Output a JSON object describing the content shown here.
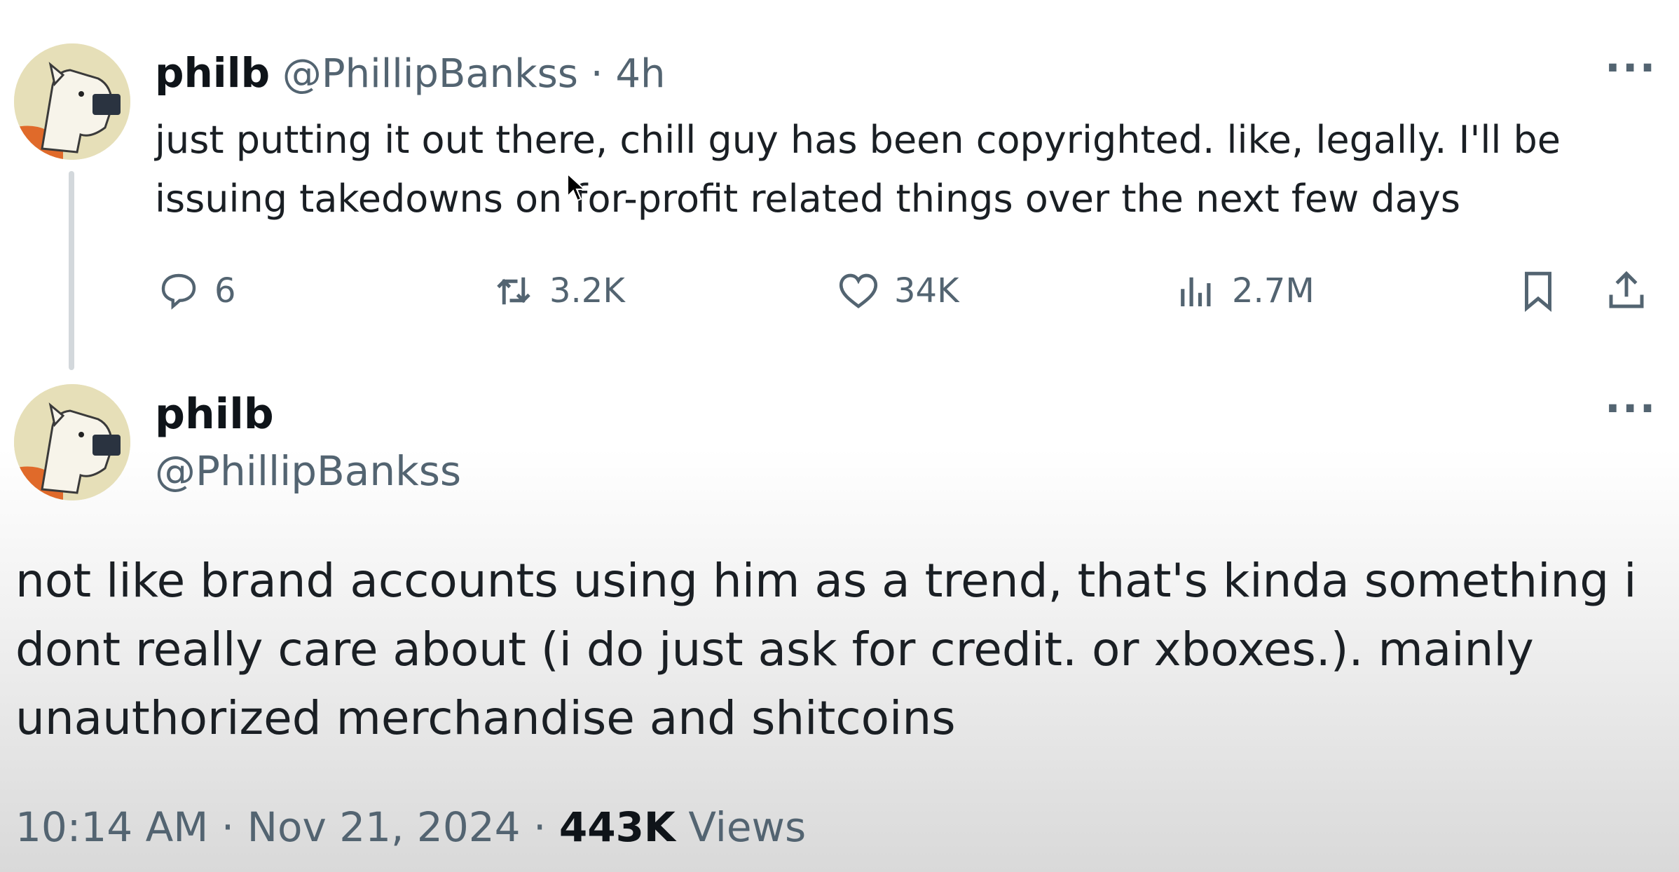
{
  "tweet1": {
    "name": "philb",
    "handle": "@PhillipBankss",
    "separator": "·",
    "time": "4h",
    "more": "···",
    "text": "just putting it out there, chill guy has been copyrighted. like, legally. I'll be issuing takedowns on for-profit related things over the next few days",
    "actions": {
      "reply": {
        "icon": "reply-icon",
        "count": "6"
      },
      "repost": {
        "icon": "repost-icon",
        "count": "3.2K"
      },
      "like": {
        "icon": "heart-icon",
        "count": "34K"
      },
      "views": {
        "icon": "views-icon",
        "count": "2.7M"
      },
      "bookmark": {
        "icon": "bookmark-icon"
      },
      "share": {
        "icon": "share-icon"
      }
    }
  },
  "tweet2": {
    "name": "philb",
    "handle": "@PhillipBankss",
    "more": "···",
    "text": "not like brand accounts using him as a trend, that's kinda something i dont really care about (i do just ask for credit. or xboxes.). mainly unauthorized merchandise and shitcoins",
    "time": "10:14 AM",
    "sep1": "·",
    "date": "Nov 21, 2024",
    "sep2": "·",
    "views_count": "443K",
    "views_label": "Views"
  },
  "colors": {
    "text": "#0f1419",
    "muted": "#536471",
    "thread_line": "#d3d8dc",
    "avatar_bg": "#e6dfb8",
    "avatar_shirt": "#e06a2a"
  }
}
